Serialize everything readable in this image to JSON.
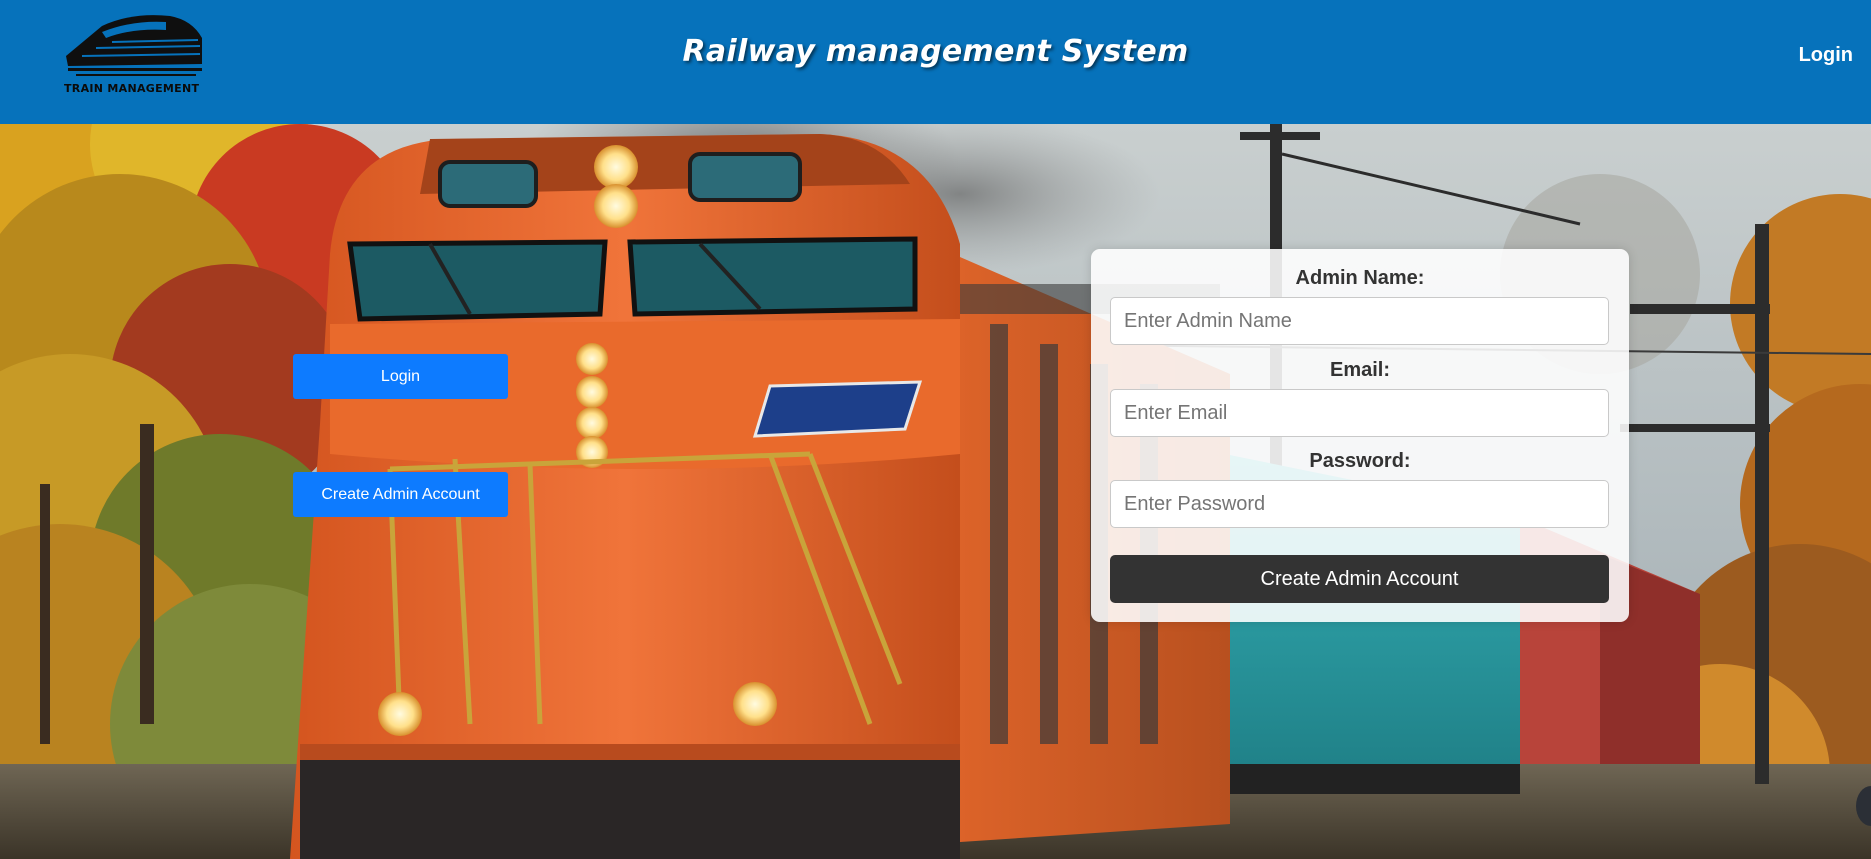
{
  "header": {
    "logo_text": "TRAIN MANAGEMENT",
    "title": "Railway management System",
    "login_link": "Login"
  },
  "side_buttons": {
    "login": "Login",
    "create_admin": "Create Admin Account"
  },
  "form": {
    "admin_name_label": "Admin Name:",
    "admin_name_placeholder": "Enter Admin Name",
    "email_label": "Email:",
    "email_placeholder": "Enter Email",
    "password_label": "Password:",
    "password_placeholder": "Enter Password",
    "submit_label": "Create Admin Account"
  },
  "colors": {
    "header_bg": "#0672bb",
    "primary_button": "#0d7bff",
    "submit_button": "#333333",
    "locomotive": "#e8692a"
  },
  "icons": {
    "logo": "train-logo-icon",
    "background": "train-photo"
  }
}
